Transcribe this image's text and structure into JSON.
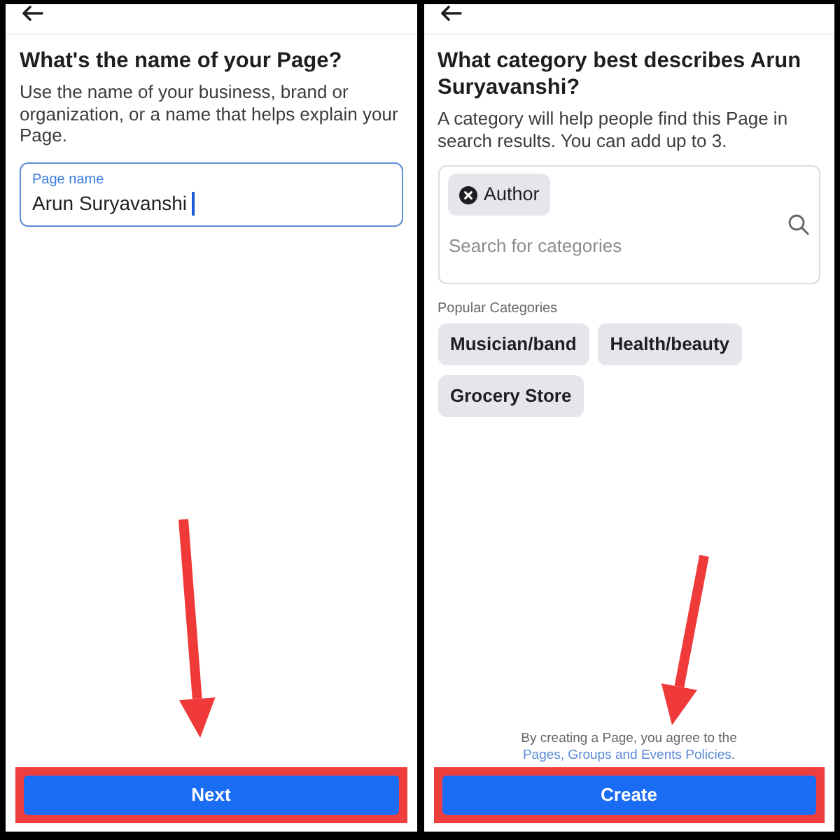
{
  "screens": [
    {
      "kind": "page_name",
      "title": "What's the name of your Page?",
      "description": "Use the name of your business, brand or organization, or a name that helps explain your Page.",
      "field": {
        "label": "Page name",
        "value": "Arun Suryavanshi",
        "focused": true
      },
      "button": {
        "label": "Next",
        "highlighted": true
      }
    },
    {
      "kind": "category",
      "title": "What category best describes Arun Suryavanshi?",
      "description": "A category will help people find this Page in search results. You can add up to 3.",
      "search": {
        "chips": [
          "Author"
        ],
        "placeholder": "Search for categories"
      },
      "popular": {
        "heading": "Popular Categories",
        "items": [
          "Musician/band",
          "Health/beauty",
          "Grocery Store"
        ]
      },
      "legal": {
        "text": "By creating a Page, you agree to the",
        "link": "Pages, Groups and Events Policies",
        "end": "."
      },
      "button": {
        "label": "Create",
        "highlighted": true
      }
    }
  ]
}
